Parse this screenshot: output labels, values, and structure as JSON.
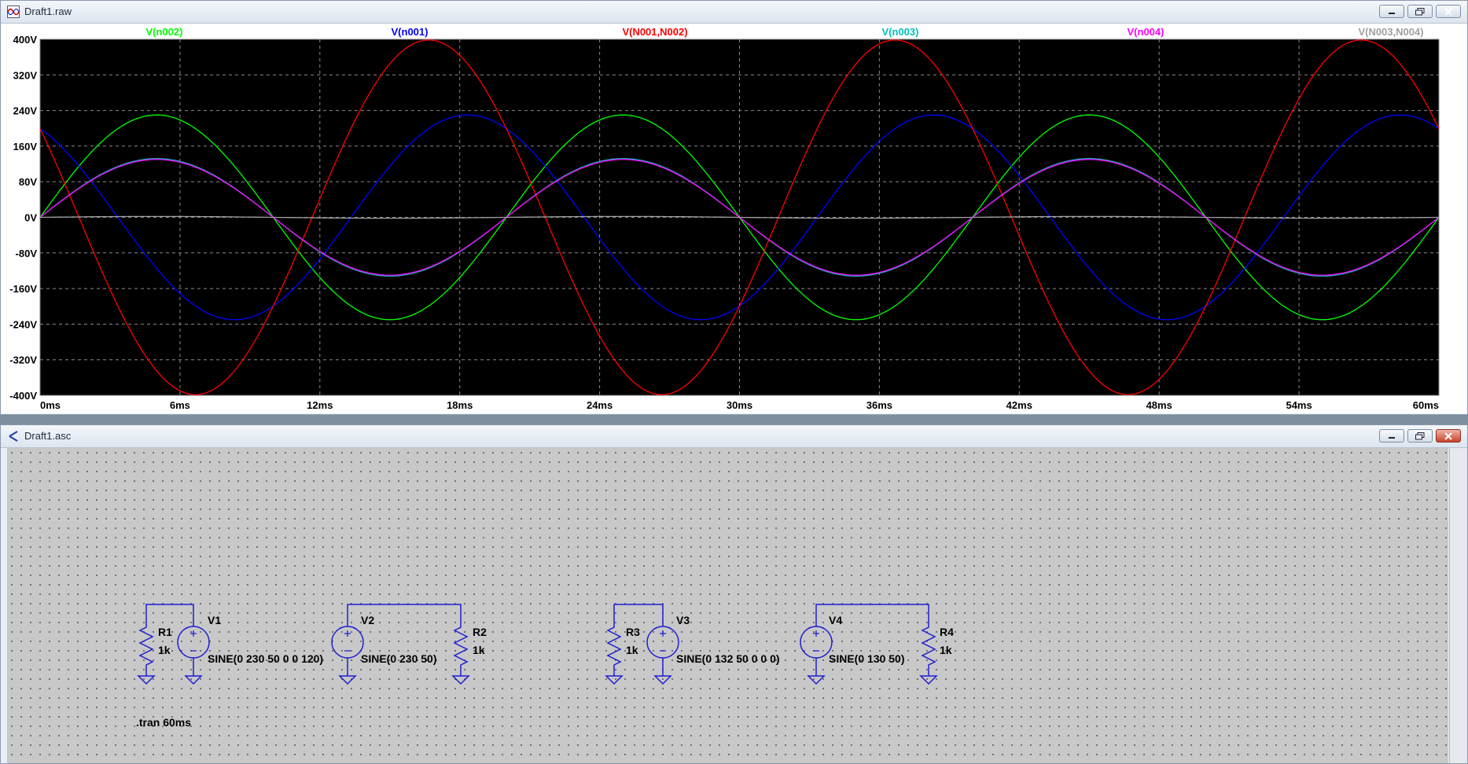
{
  "waveform_window": {
    "title": "Draft1.raw",
    "legend": [
      {
        "label": "V(n002)",
        "color": "#00ff00"
      },
      {
        "label": "V(n001)",
        "color": "#0000ff"
      },
      {
        "label": "V(N001,N002)",
        "color": "#ff0000"
      },
      {
        "label": "V(n003)",
        "color": "#00c0c0"
      },
      {
        "label": "V(n004)",
        "color": "#ff00ff"
      },
      {
        "label": "V(N003,N004)",
        "color": "#a0a0a0"
      }
    ]
  },
  "chart_data": {
    "type": "line",
    "xlabel": "",
    "ylabel": "",
    "x_ticks": [
      "0ms",
      "6ms",
      "12ms",
      "18ms",
      "24ms",
      "30ms",
      "36ms",
      "42ms",
      "48ms",
      "54ms",
      "60ms"
    ],
    "y_ticks": [
      "400V",
      "320V",
      "240V",
      "160V",
      "80V",
      "0V",
      "-80V",
      "-160V",
      "-240V",
      "-320V",
      "-400V"
    ],
    "xlim_ms": [
      0,
      60
    ],
    "ylim_V": [
      -400,
      400
    ],
    "grid": true,
    "background": "#000000",
    "series": [
      {
        "name": "V(n002)",
        "color": "#00ff00",
        "amplitude_V": 230,
        "frequency_Hz": 50,
        "phase_deg": 0
      },
      {
        "name": "V(n001)",
        "color": "#0000ff",
        "amplitude_V": 230,
        "frequency_Hz": 50,
        "phase_deg": 120
      },
      {
        "name": "V(N001,N002)",
        "color": "#ff0000",
        "amplitude_V": 398.4,
        "frequency_Hz": 50,
        "phase_deg": 150
      },
      {
        "name": "V(n003)",
        "color": "#00c0c0",
        "amplitude_V": 132,
        "frequency_Hz": 50,
        "phase_deg": 0
      },
      {
        "name": "V(n004)",
        "color": "#ff00ff",
        "amplitude_V": 130,
        "frequency_Hz": 50,
        "phase_deg": 0
      },
      {
        "name": "V(N003,N004)",
        "color": "#a0a0a0",
        "amplitude_V": 2,
        "frequency_Hz": 50,
        "phase_deg": 0
      }
    ]
  },
  "schematic_window": {
    "title": "Draft1.asc",
    "components": [
      {
        "ref": "R1",
        "value": "1k"
      },
      {
        "ref": "V1",
        "value": "SINE(0 230 50 0 0 120)"
      },
      {
        "ref": "V2",
        "value": "SINE(0 230 50)"
      },
      {
        "ref": "R2",
        "value": "1k"
      },
      {
        "ref": "R3",
        "value": "1k"
      },
      {
        "ref": "V3",
        "value": "SINE(0 132 50 0 0 0)"
      },
      {
        "ref": "V4",
        "value": "SINE(0 130 50)"
      },
      {
        "ref": "R4",
        "value": "1k"
      }
    ],
    "directive": ".tran 60ms"
  }
}
